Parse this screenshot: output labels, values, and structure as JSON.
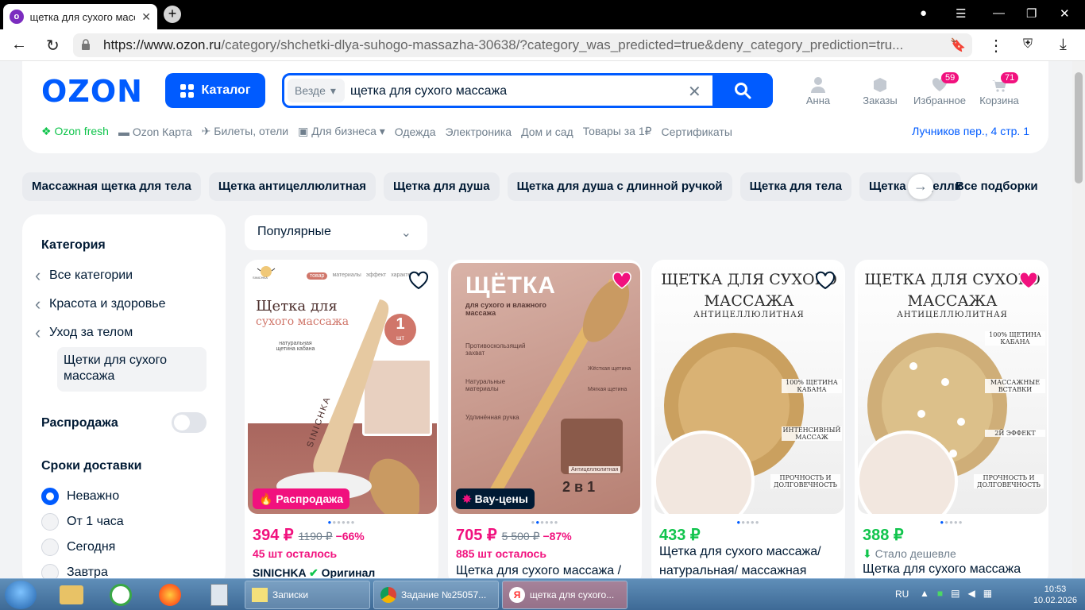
{
  "browser": {
    "tab_title": "щетка для сухого масс",
    "url_domain": "https://www.ozon.ru",
    "url_path": "/category/shchetki-dlya-suhogo-massazha-30638/?category_was_predicted=true&deny_category_prediction=tru..."
  },
  "header": {
    "logo": "OZON",
    "catalog": "Каталог",
    "search_scope": "Везде",
    "search_query": "щетка для сухого массажа",
    "user": "Анна",
    "orders": "Заказы",
    "favorites": "Избранное",
    "favorites_count": "59",
    "cart": "Корзина",
    "cart_count": "71",
    "subnav": [
      "Ozon fresh",
      "Ozon Карта",
      "Билеты, отели",
      "Для бизнеса",
      "Одежда",
      "Электроника",
      "Дом и сад",
      "Товары за 1₽",
      "Сертификаты"
    ],
    "address": "Лучников пер., 4 стр. 1"
  },
  "chips": [
    "Массажная щетка для тела",
    "Щетка антицеллюлитная",
    "Щетка для душа",
    "Щетка для душа с длинной ручкой",
    "Щетка для тела",
    "Щетка от целлюл"
  ],
  "all_selections": "Все подборки",
  "sidebar": {
    "category_title": "Категория",
    "cats": [
      "Все категории",
      "Красота и здоровье",
      "Уход за телом"
    ],
    "active_cat": "Щетки для сухого массажа",
    "sale": "Распродажа",
    "delivery_title": "Сроки доставки",
    "delivery": [
      "Неважно",
      "От 1 часа",
      "Сегодня",
      "Завтра"
    ]
  },
  "sort": "Популярные",
  "products": [
    {
      "price": "394 ₽",
      "old": "1190 ₽",
      "disc": "−66%",
      "left": "45 шт осталось",
      "brand": "SINICHKA",
      "orig": "Оригинал",
      "promo": "Распродажа",
      "img_title": "Щетка для",
      "img_sub": "сухого массажа",
      "img_note": "натуральная щетина кабана",
      "img_qty": "1",
      "img_qty_unit": "шт",
      "img_brand": "SINICHKA",
      "img_tabs": [
        "товар",
        "материалы",
        "эффект",
        "характери"
      ]
    },
    {
      "price": "705 ₽",
      "old": "5 500 ₽",
      "disc": "−87%",
      "left": "885 шт осталось",
      "name": "Щетка для сухого массажа /",
      "promo": "Вау-цены",
      "img_title": "ЩЁТКА",
      "img_sub": "для сухого и влажного массажа",
      "img_f1": "Противоскользящий захват",
      "img_f2": "Натуральные материалы",
      "img_f3": "Удлинённая ручка",
      "img_hard": "Жёсткая щетина",
      "img_soft": "Мягкая щетина",
      "img_anti": "Антицеллюлитная",
      "img_2in1": "2 в 1"
    },
    {
      "price": "433 ₽",
      "name": "Щетка для сухого массажа/ натуральная/ массажная",
      "img_title": "ЩЕТКА ДЛЯ СУХОГО МАССАЖА",
      "img_sub": "АНТИЦЕЛЛЮЛИТНАЯ",
      "img_f1": "100% ЩЕТИНА КАБАНА",
      "img_f2": "ИНТЕНСИВНЫЙ МАССАЖ",
      "img_f3": "ПРОЧНОСТЬ И ДОЛГОВЕЧНОСТЬ"
    },
    {
      "price": "388 ₽",
      "cheaper": "Стало дешевле",
      "name": "Щетка для сухого массажа",
      "img_title": "ЩЕТКА ДЛЯ СУХОГО МАССАЖА",
      "img_sub": "АНТИЦЕЛЛЮЛИТНАЯ",
      "img_f1": "100% ЩЕТИНА КАБАНА",
      "img_f2": "МАССАЖНЫЕ ВСТАВКИ",
      "img_f3": "2Й ЭФФЕКТ",
      "img_f4": "ПРОЧНОСТЬ И ДОЛГОВЕЧНОСТЬ"
    }
  ],
  "taskbar": {
    "win1": "Записки",
    "win2": "Задание №25057...",
    "win3": "щетка для сухого...",
    "lang": "RU",
    "time": "10:53",
    "date": "10.02.2026"
  }
}
